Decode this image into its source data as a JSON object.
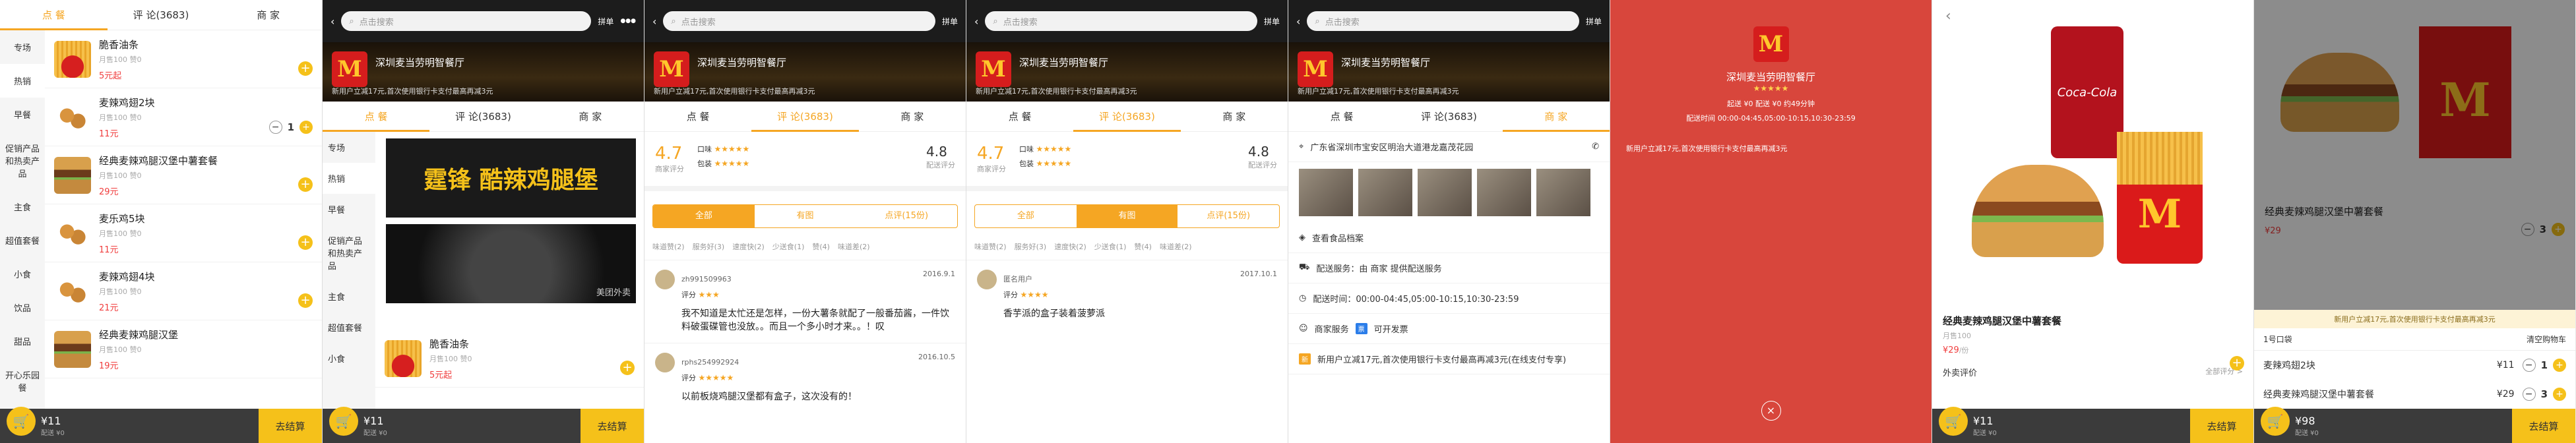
{
  "tabs": {
    "order": "点 餐",
    "reviews": "评 论(3683)",
    "merchant": "商 家"
  },
  "search_placeholder": "点击搜索",
  "topbar": {
    "share": "拼单",
    "more": "●●●"
  },
  "shop": {
    "name": "深圳麦当劳明智餐厅",
    "logo": "M",
    "notice": "新用户立减17元,首次使用银行卡支付最高再减3元",
    "activity": "5个活动"
  },
  "categories": [
    "专场",
    "热销",
    "早餐",
    "促销产品和热卖产品",
    "主食",
    "超值套餐",
    "小食",
    "饮品",
    "甜品",
    "开心乐园餐"
  ],
  "hot_badge": "1",
  "items": [
    {
      "name": "脆香油条",
      "sub": "月售100 赞0",
      "price": "5元起"
    },
    {
      "name": "麦辣鸡翅2块",
      "sub": "月售100 赞0",
      "price": "11元"
    },
    {
      "name": "经典麦辣鸡腿汉堡中薯套餐",
      "sub": "月售100 赞0",
      "price": "29元"
    },
    {
      "name": "麦乐鸡5块",
      "sub": "月售100 赞0",
      "price": "11元"
    },
    {
      "name": "麦辣鸡翅4块",
      "sub": "月售100 赞0",
      "price": "21元"
    },
    {
      "name": "经典麦辣鸡腿汉堡",
      "sub": "月售100 赞0",
      "price": "19元"
    }
  ],
  "qty_one": "1",
  "cart": {
    "total": "¥11",
    "sub": "配送 ¥0",
    "checkout": "去结算",
    "badge": "1"
  },
  "banners": [
    "霆锋 酷辣鸡腿堡",
    "美团外卖"
  ],
  "rating": {
    "score": "4.7",
    "score_label": "商家评分",
    "taste": "口味",
    "pack": "包装",
    "delivery_score": "4.8",
    "delivery_label": "配送评分",
    "stars": "★★★★★"
  },
  "filters": [
    "全部",
    "有图",
    "点评(15份)"
  ],
  "tags": [
    "味道赞(2)",
    "服务好(3)",
    "速度快(2)",
    "少送食(1)",
    "赞(4)",
    "味道差(2)"
  ],
  "comments": [
    {
      "user": "zh991509963",
      "date": "2016.9.1",
      "score": "评分",
      "stars": "★★★",
      "text": "我不知道是太忙还是怎样，一份大薯条就配了一般番茄酱，一件饮料破蛋碟管也没放。。而且一个多小时才来。。！叹"
    },
    {
      "user": "rphs254992924",
      "date": "2016.10.5",
      "score": "评分",
      "stars": "★★★★★",
      "text": "以前板烧鸡腿汉堡都有盒子，这次没有的！"
    }
  ],
  "photo_comment": {
    "user": "匿名用户",
    "date": "2017.10.1",
    "score": "评分",
    "stars": "★★★★",
    "text": "香芋派的盒子装着菠萝派"
  },
  "merchant": {
    "address": "广东省深圳市宝安区明治大道港龙嘉茂花园",
    "qualification": "查看食品档案",
    "delivery_service": "配送服务：由 商家 提供配送服务",
    "delivery_time": "配送时间：00:00-04:45,05:00-10:15,10:30-23:59",
    "services": "商家服务",
    "invoice": "可开发票",
    "promo": "新用户立减17元,首次使用银行卡支付最高再减3元(在线支付专享)"
  },
  "overlay": {
    "stars": "★★★★★",
    "delivery": "起送 ¥0 配送 ¥0 约49分钟",
    "time_label": "配送时间",
    "time": "00:00-04:45,05:00-10:15,10:30-23:59",
    "promo": "新用户立减17元,首次使用银行卡支付最高再减3元"
  },
  "detail": {
    "name": "经典麦辣鸡腿汉堡中薯套餐",
    "sub": "月售100",
    "price": "¥29",
    "unit": "/份",
    "rating_label": "外卖评价",
    "see_all": "全部评分 >",
    "brand": "Coca-Cola"
  },
  "cart_modal": {
    "name": "经典麦辣鸡腿汉堡中薯套餐",
    "price": "¥29",
    "promo": "新用户立减17元,首次使用银行卡支付最高再减3元",
    "box": "1号口袋",
    "clear": "清空购物车",
    "rows": [
      {
        "name": "麦辣鸡翅2块",
        "price": "¥11",
        "qty": "1"
      },
      {
        "name": "经典麦辣鸡腿汉堡中薯套餐",
        "price": "¥29",
        "qty": "3"
      }
    ],
    "total": "¥98",
    "qty_top": "3"
  },
  "colors": {
    "accent": "#f5a623",
    "price": "#f03d3d",
    "dark": "#3b3b3b"
  }
}
